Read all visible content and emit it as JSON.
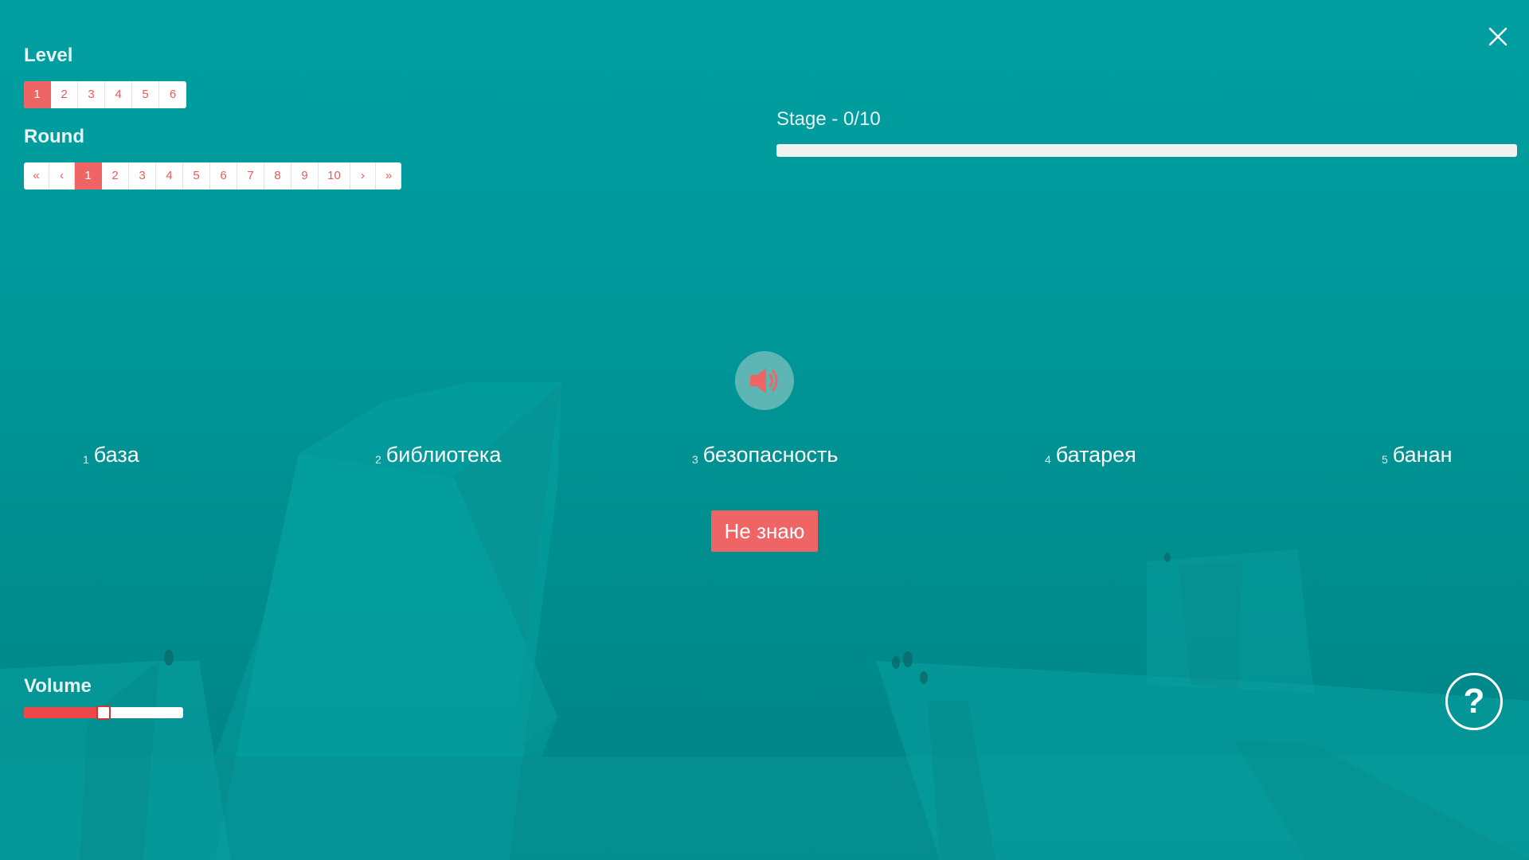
{
  "level": {
    "label": "Level",
    "pages": [
      "1",
      "2",
      "3",
      "4",
      "5",
      "6"
    ],
    "active": "1"
  },
  "round": {
    "label": "Round",
    "first": "«",
    "prev": "‹",
    "pages": [
      "1",
      "2",
      "3",
      "4",
      "5",
      "6",
      "7",
      "8",
      "9",
      "10"
    ],
    "next": "›",
    "last": "»",
    "active": "1"
  },
  "stage": {
    "label": "Stage - 0/10",
    "progress": 0
  },
  "words": [
    {
      "num": "1",
      "text": "база"
    },
    {
      "num": "2",
      "text": "библиотека"
    },
    {
      "num": "3",
      "text": "безопасность"
    },
    {
      "num": "4",
      "text": "батарея"
    },
    {
      "num": "5",
      "text": "банан"
    }
  ],
  "dont_know_label": "Не знаю",
  "volume": {
    "label": "Volume",
    "value": 0.5
  },
  "help_label": "?",
  "icons": {
    "close": "close-icon",
    "speaker": "speaker-icon"
  },
  "colors": {
    "accent": "#ef6464",
    "background": "#009a9c"
  }
}
